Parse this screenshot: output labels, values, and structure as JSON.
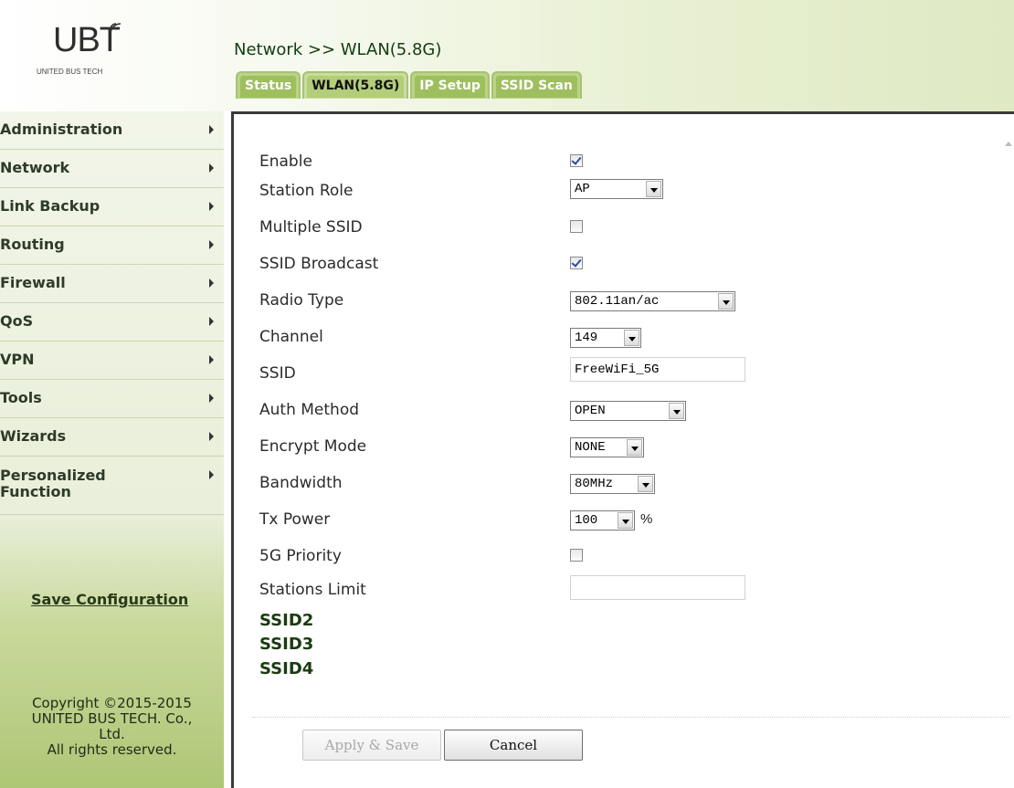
{
  "header": {
    "logo_text": "UBT",
    "logo_subtitle": "UNITED BUS TECH",
    "breadcrumb": "Network >> WLAN(5.8G)"
  },
  "tabs": [
    {
      "label": "Status",
      "active": false
    },
    {
      "label": "WLAN(5.8G)",
      "active": true
    },
    {
      "label": "IP Setup",
      "active": false
    },
    {
      "label": "SSID Scan",
      "active": false
    }
  ],
  "sidebar": {
    "items": [
      {
        "label": "Administration"
      },
      {
        "label": "Network"
      },
      {
        "label": "Link Backup"
      },
      {
        "label": "Routing"
      },
      {
        "label": "Firewall"
      },
      {
        "label": "QoS"
      },
      {
        "label": "VPN"
      },
      {
        "label": "Tools"
      },
      {
        "label": "Wizards"
      },
      {
        "label": "Personalized Function"
      }
    ],
    "save_configuration": "Save Configuration",
    "copyright_lines": [
      "Copyright ©2015-2015",
      "UNITED BUS TECH. Co.,",
      "Ltd.",
      "All rights reserved."
    ]
  },
  "form": {
    "enable": {
      "label": "Enable",
      "checked": true
    },
    "station_role": {
      "label": "Station Role",
      "value": "AP"
    },
    "multiple_ssid": {
      "label": "Multiple SSID",
      "checked": false
    },
    "ssid_broadcast": {
      "label": "SSID Broadcast",
      "checked": true
    },
    "radio_type": {
      "label": "Radio Type",
      "value": "802.11an/ac"
    },
    "channel": {
      "label": "Channel",
      "value": "149"
    },
    "ssid": {
      "label": "SSID",
      "value": "FreeWiFi_5G"
    },
    "auth_method": {
      "label": "Auth Method",
      "value": "OPEN"
    },
    "encrypt_mode": {
      "label": "Encrypt Mode",
      "value": "NONE"
    },
    "bandwidth": {
      "label": "Bandwidth",
      "value": "80MHz"
    },
    "tx_power": {
      "label": "Tx Power",
      "value": "100",
      "unit": "%"
    },
    "g5_priority": {
      "label": "5G Priority",
      "checked": false
    },
    "stations_limit": {
      "label": "Stations Limit",
      "value": ""
    }
  },
  "ssid_links": [
    "SSID2",
    "SSID3",
    "SSID4"
  ],
  "buttons": {
    "apply_save": "Apply & Save",
    "cancel": "Cancel"
  }
}
